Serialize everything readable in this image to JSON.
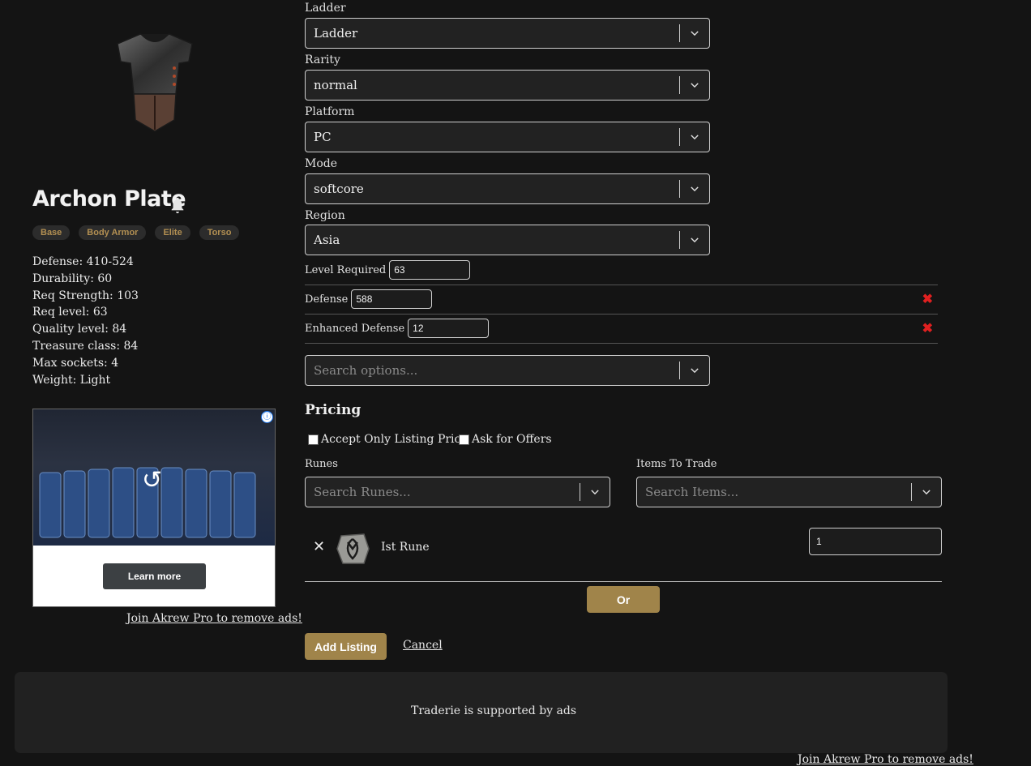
{
  "item": {
    "name": "Archon Plate",
    "tags": [
      "Base",
      "Body Armor",
      "Elite",
      "Torso"
    ],
    "stats": [
      "Defense: 410-524",
      "Durability: 60",
      "Req Strength: 103",
      "Req level: 63",
      "Quality level: 84",
      "Treasure class: 84",
      "Max sockets: 4",
      "Weight: Light"
    ]
  },
  "ad": {
    "button_label": "Learn more",
    "info_glyph": "ⓘ",
    "replay_glyph": "↺",
    "pro_link": "Join Akrew Pro to remove ads!"
  },
  "form": {
    "selects": [
      {
        "label": "Ladder",
        "value": "Ladder"
      },
      {
        "label": "Rarity",
        "value": "normal"
      },
      {
        "label": "Platform",
        "value": "PC"
      },
      {
        "label": "Mode",
        "value": "softcore"
      },
      {
        "label": "Region",
        "value": "Asia"
      }
    ],
    "properties": [
      {
        "label": "Level Required",
        "value": "63",
        "removable": false
      },
      {
        "label": "Defense",
        "value": "588",
        "removable": true
      },
      {
        "label": "Enhanced Defense",
        "value": "12",
        "removable": true
      }
    ],
    "remove_glyph": "✖",
    "search_options_placeholder": "Search options..."
  },
  "pricing": {
    "title": "Pricing",
    "checkbox_listing_price": "Accept Only Listing Price",
    "checkbox_offers": "Ask for Offers",
    "runes_label": "Runes",
    "runes_placeholder": "Search Runes...",
    "items_label": "Items To Trade",
    "items_placeholder": "Search Items...",
    "selected_rune": {
      "name": "Ist Rune",
      "quantity": "1"
    },
    "remove_glyph": "✕",
    "or_label": "Or",
    "add_listing_label": "Add Listing",
    "cancel_label": "Cancel"
  },
  "footer": {
    "ad_text": "Traderie is supported by ads",
    "pro_link": "Join Akrew Pro to remove ads!"
  },
  "colors": {
    "background": "#141414",
    "accent_gold": "#a0844a",
    "tag_text": "#b28f52",
    "remove_red": "#e02020"
  }
}
